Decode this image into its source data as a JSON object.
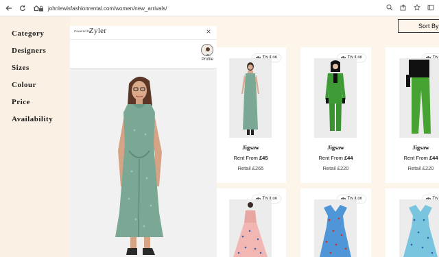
{
  "browser": {
    "url": "johnlewisfashionrental.com/women/new_arrivals/"
  },
  "filters": {
    "items": [
      "Category",
      "Designers",
      "Sizes",
      "Colour",
      "Price",
      "Availability"
    ]
  },
  "zyler": {
    "powered_by": "Powered by",
    "brand": "Zyler",
    "close": "×",
    "profile_label": "Profile"
  },
  "sort": {
    "label": "Sort By"
  },
  "tryon_label": "Try it on",
  "products": [
    {
      "designer": "Jigsaw",
      "rent_prefix": "Rent From ",
      "rent_price": "£45",
      "retail": "Retail £265",
      "color": "#7aa894"
    },
    {
      "designer": "Jigsaw",
      "rent_prefix": "Rent From ",
      "rent_price": "£44",
      "retail": "Retail £220",
      "color": "#3e9a34"
    },
    {
      "designer": "Jigsaw",
      "rent_prefix": "Rent From ",
      "rent_price": "£44",
      "retail": "Retail £220",
      "color": "#46a332"
    },
    {
      "designer": "",
      "color": "#f2b7b2"
    },
    {
      "designer": "",
      "color": "#4f96d8"
    },
    {
      "designer": "",
      "color": "#79c5e0"
    }
  ],
  "colors": {
    "page_bg": "#fdf4ea",
    "sidebar_bg": "#fbf0e4"
  }
}
